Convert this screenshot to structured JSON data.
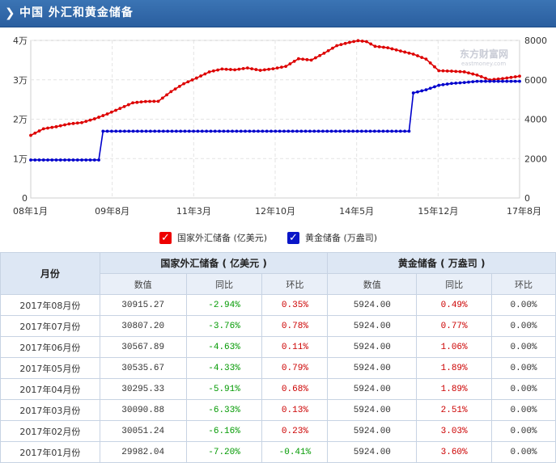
{
  "header": {
    "title": "中国 外汇和黄金储备"
  },
  "legend": {
    "forex": "国家外汇储备 (亿美元)",
    "gold": "黄金储备 (万盎司)"
  },
  "watermark": {
    "name": "东方财富网",
    "url": "eastmoney.com"
  },
  "colors": {
    "forex": "#dd0000",
    "gold": "#0000cc",
    "header": "#2f68aa"
  },
  "chart_data": {
    "type": "line",
    "x_ticks": [
      "08年1月",
      "09年8月",
      "11年3月",
      "12年10月",
      "14年5月",
      "15年12月",
      "17年8月"
    ],
    "x_range": [
      "2008-01",
      "2017-08"
    ],
    "y_left": {
      "ticks": [
        "0",
        "1万",
        "2万",
        "3万",
        "4万"
      ],
      "range": [
        0,
        40000
      ]
    },
    "y_right": {
      "ticks": [
        "0",
        "2000",
        "4000",
        "6000",
        "8000"
      ],
      "range": [
        0,
        8000
      ]
    },
    "grid": true,
    "legend_position": "bottom",
    "series": [
      {
        "name": "国家外汇储备 (亿美元)",
        "axis": "left",
        "color": "#dd0000",
        "points": [
          [
            "2008-01",
            15898
          ],
          [
            "2008-04",
            17566
          ],
          [
            "2008-07",
            18088
          ],
          [
            "2008-10",
            18793
          ],
          [
            "2009-01",
            19134
          ],
          [
            "2009-04",
            20088
          ],
          [
            "2009-07",
            21316
          ],
          [
            "2009-10",
            22730
          ],
          [
            "2010-01",
            24152
          ],
          [
            "2010-04",
            24491
          ],
          [
            "2010-07",
            24543
          ],
          [
            "2010-10",
            27000
          ],
          [
            "2011-01",
            29000
          ],
          [
            "2011-04",
            30448
          ],
          [
            "2011-07",
            32000
          ],
          [
            "2011-10",
            32738
          ],
          [
            "2012-01",
            32536
          ],
          [
            "2012-04",
            33000
          ],
          [
            "2012-07",
            32400
          ],
          [
            "2012-10",
            32800
          ],
          [
            "2013-01",
            33400
          ],
          [
            "2013-04",
            35345
          ],
          [
            "2013-07",
            35000
          ],
          [
            "2013-10",
            36736
          ],
          [
            "2014-01",
            38666
          ],
          [
            "2014-04",
            39500
          ],
          [
            "2014-06",
            39932
          ],
          [
            "2014-08",
            39688
          ],
          [
            "2014-10",
            38500
          ],
          [
            "2015-01",
            38134
          ],
          [
            "2015-04",
            37300
          ],
          [
            "2015-07",
            36513
          ],
          [
            "2015-10",
            35255
          ],
          [
            "2016-01",
            32309
          ],
          [
            "2016-04",
            32197
          ],
          [
            "2016-07",
            32011
          ],
          [
            "2016-10",
            31206
          ],
          [
            "2017-01",
            29982
          ],
          [
            "2017-04",
            30295
          ],
          [
            "2017-08",
            30915
          ]
        ]
      },
      {
        "name": "黄金储备 (万盎司)",
        "axis": "right",
        "color": "#0000cc",
        "points": [
          [
            "2008-01",
            1929
          ],
          [
            "2009-05",
            1929
          ],
          [
            "2009-06",
            3389
          ],
          [
            "2015-06",
            3389
          ],
          [
            "2015-07",
            5331
          ],
          [
            "2015-10",
            5493
          ],
          [
            "2016-01",
            5720
          ],
          [
            "2016-04",
            5814
          ],
          [
            "2016-07",
            5862
          ],
          [
            "2016-10",
            5924
          ],
          [
            "2017-08",
            5924
          ]
        ]
      }
    ]
  },
  "table": {
    "month_header": "月份",
    "groups": [
      "国家外汇储备 ( 亿美元 )",
      "黄金储备 ( 万盎司 )"
    ],
    "sub_headers": [
      "数值",
      "同比",
      "环比",
      "数值",
      "同比",
      "环比"
    ],
    "rows": [
      {
        "month": "2017年08月份",
        "fv": "30915.27",
        "fy": "-2.94%",
        "fm": "0.35%",
        "gv": "5924.00",
        "gy": "0.49%",
        "gm": "0.00%"
      },
      {
        "month": "2017年07月份",
        "fv": "30807.20",
        "fy": "-3.76%",
        "fm": "0.78%",
        "gv": "5924.00",
        "gy": "0.77%",
        "gm": "0.00%"
      },
      {
        "month": "2017年06月份",
        "fv": "30567.89",
        "fy": "-4.63%",
        "fm": "0.11%",
        "gv": "5924.00",
        "gy": "1.06%",
        "gm": "0.00%"
      },
      {
        "month": "2017年05月份",
        "fv": "30535.67",
        "fy": "-4.33%",
        "fm": "0.79%",
        "gv": "5924.00",
        "gy": "1.89%",
        "gm": "0.00%"
      },
      {
        "month": "2017年04月份",
        "fv": "30295.33",
        "fy": "-5.91%",
        "fm": "0.68%",
        "gv": "5924.00",
        "gy": "1.89%",
        "gm": "0.00%"
      },
      {
        "month": "2017年03月份",
        "fv": "30090.88",
        "fy": "-6.33%",
        "fm": "0.13%",
        "gv": "5924.00",
        "gy": "2.51%",
        "gm": "0.00%"
      },
      {
        "month": "2017年02月份",
        "fv": "30051.24",
        "fy": "-6.16%",
        "fm": "0.23%",
        "gv": "5924.00",
        "gy": "3.03%",
        "gm": "0.00%"
      },
      {
        "month": "2017年01月份",
        "fv": "29982.04",
        "fy": "-7.20%",
        "fm": "-0.41%",
        "gv": "5924.00",
        "gy": "3.60%",
        "gm": "0.00%"
      }
    ]
  }
}
